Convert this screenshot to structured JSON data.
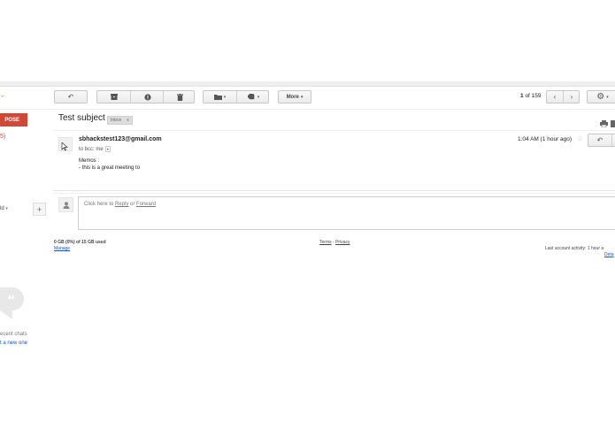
{
  "toolbar": {
    "back_icon": "back-arrow-icon",
    "archive_icon": "archive-icon",
    "spam_icon": "report-spam-icon",
    "delete_icon": "trash-icon",
    "move_icon": "folder-icon",
    "labels_icon": "label-tag-icon",
    "more_label": "More",
    "page_current": "1",
    "page_total": "of 159",
    "settings_icon": "gear-icon"
  },
  "sidebar": {
    "compose_label": "POSE",
    "inbox_count": "5)",
    "chat_status": "ld",
    "hangouts_icon": "hangouts-quote-icon",
    "no_recent_chats": "ecent chats",
    "start_new": "t a new one"
  },
  "message": {
    "subject": "Test subject",
    "label": "Inbox",
    "label_remove": "x",
    "sender": "sbhackstest123@gmail.com",
    "to": "to bcc: me",
    "time": "1:04 AM (1 hour ago)",
    "body_line1": "Memos :",
    "body_line2": "- this is a great meeting to"
  },
  "reply": {
    "prefix": "Click here to ",
    "reply_link": "Reply",
    "or": " or ",
    "forward_link": "Forward"
  },
  "footer": {
    "storage": "0 GB (0%) of 15 GB used",
    "manage": "Manage",
    "terms": "Terms",
    "sep": " - ",
    "privacy": "Privacy",
    "activity": "Last account activity: 1 hour a",
    "details": "Deta"
  },
  "colors": {
    "accent": "#d14836",
    "link": "#1155cc"
  }
}
